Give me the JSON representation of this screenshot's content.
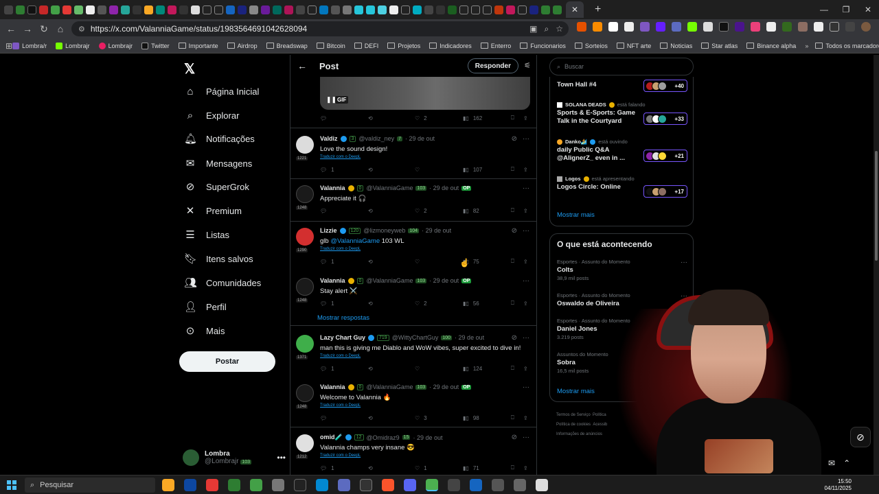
{
  "browser": {
    "url": "https://x.com/ValanniaGame/status/1983564691042628094",
    "bookmarks": [
      "Lombra/r",
      "Lombrajr",
      "Lombrajr",
      "Twitter",
      "Importante",
      "Airdrop",
      "Breadswap",
      "Bitcoin",
      "DEFI",
      "Projetos",
      "Indicadores",
      "Enterro",
      "Funcionarios",
      "Sorteios",
      "NFT arte",
      "Noticias",
      "Star atlas",
      "Binance alpha"
    ],
    "all_bookmarks": "Todos os marcadores",
    "active_tab_close": "✕",
    "new_tab": "+"
  },
  "nav": {
    "items": [
      {
        "label": "Página Inicial",
        "icon": "home-icon"
      },
      {
        "label": "Explorar",
        "icon": "search-icon"
      },
      {
        "label": "Notificações",
        "icon": "bell-icon"
      },
      {
        "label": "Mensagens",
        "icon": "mail-icon"
      },
      {
        "label": "SuperGrok",
        "icon": "grok-icon"
      },
      {
        "label": "Premium",
        "icon": "x-icon"
      },
      {
        "label": "Listas",
        "icon": "list-icon"
      },
      {
        "label": "Itens salvos",
        "icon": "bookmark-icon"
      },
      {
        "label": "Comunidades",
        "icon": "people-icon"
      },
      {
        "label": "Perfil",
        "icon": "person-icon"
      },
      {
        "label": "Mais",
        "icon": "more-circle-icon"
      }
    ],
    "post_button": "Postar",
    "account": {
      "name": "Lombra",
      "handle": "@Lombrajr",
      "level": "103"
    }
  },
  "column": {
    "title": "Post",
    "reply_button": "Responder",
    "gif_label": "GIF",
    "gif_actions": {
      "likes": "2",
      "views": "162"
    },
    "tweets": [
      {
        "name": "Valdiz",
        "score": "3",
        "handle": "@valdiz_ney",
        "level": "7",
        "date": "29 de out",
        "text": "Love the sound design!",
        "translate": "Traduzir com o DeepL",
        "badge": "1221",
        "replies": "1",
        "likes": "",
        "views": "107",
        "op": false,
        "color": "#d8d8d8"
      },
      {
        "name": "Valannia",
        "score": "0",
        "handle": "@ValanniaGame",
        "level": "103",
        "date": "29 de out",
        "text": "Appreciate it 🎧",
        "translate": "",
        "badge": "1248",
        "replies": "",
        "likes": "2",
        "views": "82",
        "op": true,
        "color": "#1a1a1a"
      },
      {
        "name": "Lizzie",
        "score": "120",
        "handle": "@lizmoneyweb",
        "level": "104",
        "date": "29 de out",
        "text_pre": "glb ",
        "mention": "@ValanniaGame",
        "text_post": " 103  WL",
        "translate": "Traduzir com o DeepL",
        "badge": "1290",
        "replies": "1",
        "likes": "",
        "views": "75",
        "op": false,
        "color": "#d33"
      },
      {
        "name": "Valannia",
        "score": "0",
        "handle": "@ValanniaGame",
        "level": "103",
        "date": "29 de out",
        "text": "Stay alert ⚔️",
        "translate": "",
        "badge": "1248",
        "replies": "1",
        "likes": "2",
        "views": "56",
        "op": true,
        "color": "#1a1a1a"
      },
      {
        "name": "Lazy Chart Guy",
        "score": "719",
        "handle": "@WittyChartGuy",
        "level": "100",
        "date": "29 de out",
        "text": "man this is giving me Diablo and WoW vibes, super excited to dive in!",
        "translate": "Traduzir com o DeepL",
        "badge": "1371",
        "replies": "1",
        "likes": "",
        "views": "124",
        "op": false,
        "color": "#3fae4a"
      },
      {
        "name": "Valannia",
        "score": "0",
        "handle": "@ValanniaGame",
        "level": "103",
        "date": "29 de out",
        "text": "Welcome to Valannia 🔥",
        "translate": "Traduzir com o DeepL",
        "badge": "1248",
        "replies": "",
        "likes": "3",
        "views": "98",
        "op": true,
        "color": "#1a1a1a"
      },
      {
        "name": "omid🧪",
        "score": "12",
        "handle": "@Omidraz9",
        "level": "15",
        "date": "29 de out",
        "text": "Valannia champs very insane 😎",
        "translate": "Traduzir com o DeepL",
        "badge": "1212",
        "replies": "1",
        "likes": "1",
        "views": "71",
        "op": false,
        "color": "#ddd"
      }
    ],
    "show_replies": "Mostrar respostas"
  },
  "right": {
    "search_placeholder": "Buscar",
    "spaces": [
      {
        "host": "",
        "status": "",
        "title": "Town Hall #4",
        "count": "+40"
      },
      {
        "host": "SOLANA DEADS",
        "status": "está falando",
        "title": "Sports & E-Sports: Game Talk in the Courtyard",
        "count": "+33"
      },
      {
        "host": "Danko🏄",
        "status": "está ouvindo",
        "title": "daily Public Q&A @AlignerZ_ even in ...",
        "count": "+21"
      },
      {
        "host": "Logos",
        "status": "está apresentando",
        "title": "Logos Circle: Online",
        "count": "+17"
      }
    ],
    "show_more": "Mostrar mais",
    "trends_title": "O que está acontecendo",
    "trends": [
      {
        "category": "Esportes · Assunto do Momento",
        "name": "Colts",
        "posts": "38,9 mil posts"
      },
      {
        "category": "Esportes · Assunto do Momento",
        "name": "Oswaldo de Oliveira",
        "posts": ""
      },
      {
        "category": "Esportes · Assunto do Momento",
        "name": "Daniel Jones",
        "posts": "3.219 posts"
      },
      {
        "category": "Assuntos do Momento",
        "name": "Sobra",
        "posts": "16,5 mil posts"
      }
    ],
    "show_more_trends": "Mostrar mais",
    "footer": [
      "Termos de Serviço",
      "Política",
      "Política de cookies",
      "Acessib",
      "Informações de anúncios"
    ]
  },
  "taskbar": {
    "search": "Pesquisar",
    "time": "15:50",
    "date": "04/11/2025"
  }
}
